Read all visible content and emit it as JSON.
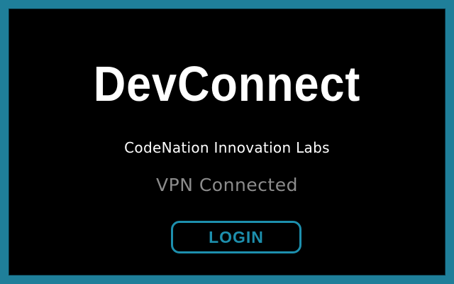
{
  "app": {
    "title": "DevConnect",
    "organization": "CodeNation Innovation Labs",
    "status": "VPN Connected",
    "login_label": "LOGIN"
  },
  "colors": {
    "accent": "#1d8fad",
    "popup_border": "#1f7f9a",
    "background": "#000000",
    "title_text": "#ffffff",
    "status_text": "#8c8c8c",
    "page_top": "#0f67ab"
  }
}
